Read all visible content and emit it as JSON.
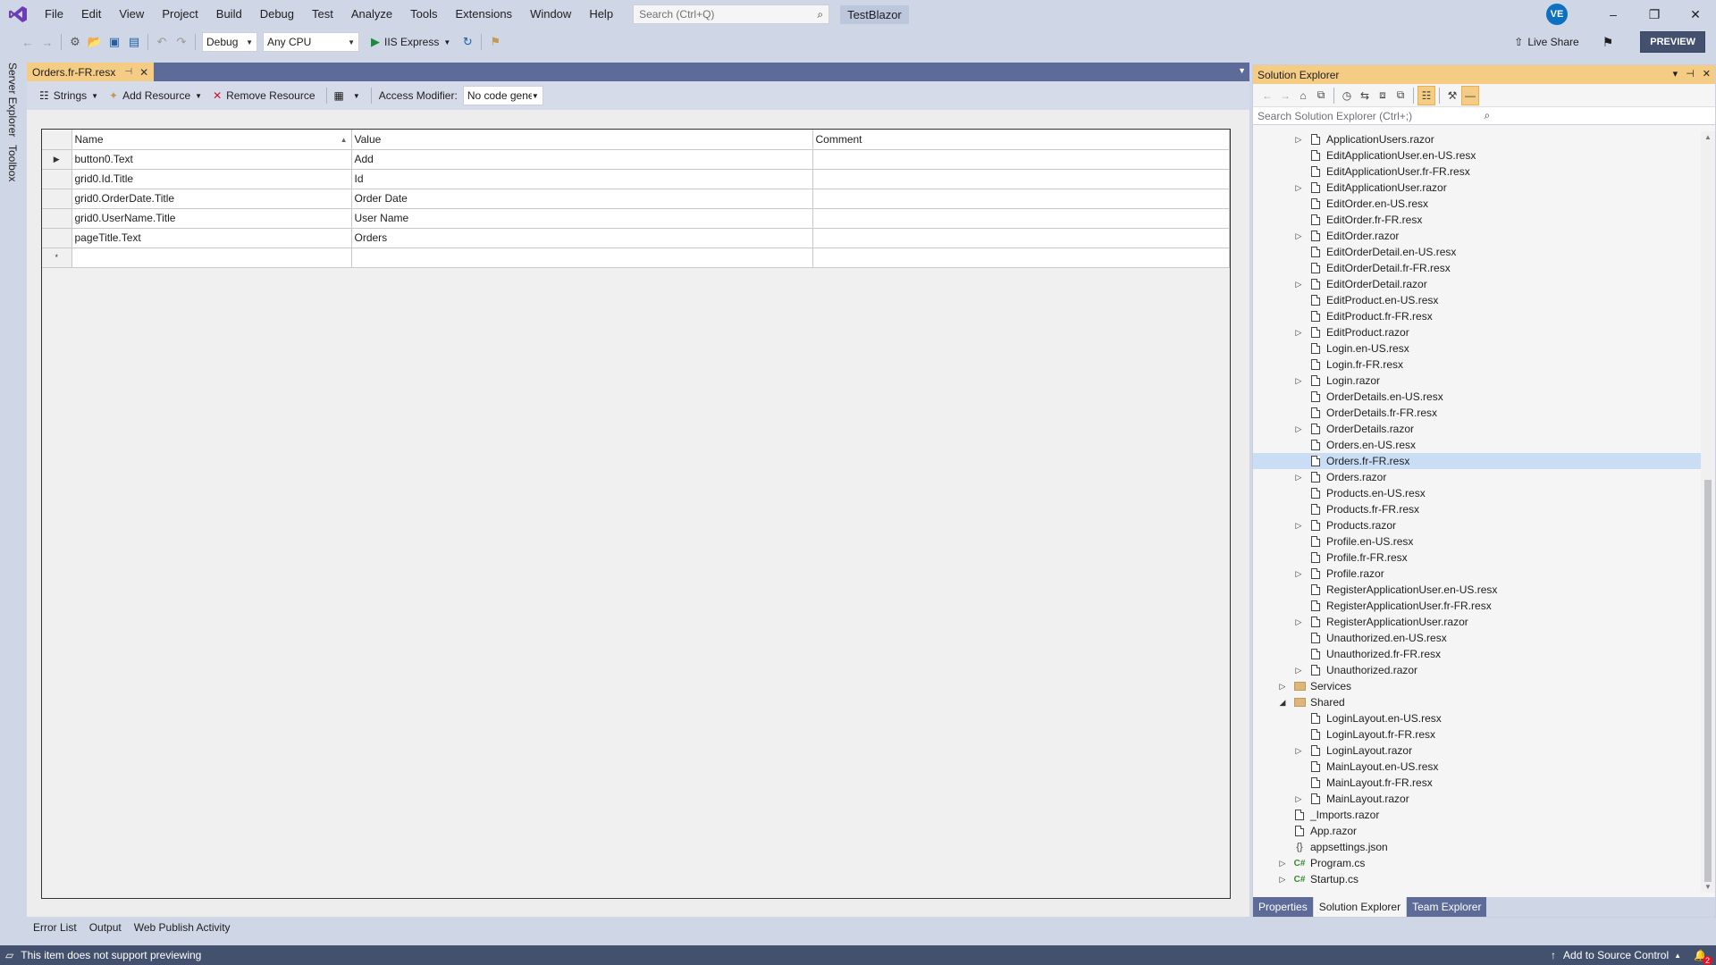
{
  "menu": {
    "items": [
      "File",
      "Edit",
      "View",
      "Project",
      "Build",
      "Debug",
      "Test",
      "Analyze",
      "Tools",
      "Extensions",
      "Window",
      "Help"
    ],
    "search_placeholder": "Search (Ctrl+Q)",
    "solution_name": "TestBlazor",
    "avatar_initials": "VE"
  },
  "toolbar": {
    "configuration": "Debug",
    "platform": "Any CPU",
    "run_label": "IIS Express",
    "live_share": "Live Share",
    "preview": "PREVIEW"
  },
  "left_dock": {
    "tabs": [
      "Server Explorer",
      "Toolbox"
    ]
  },
  "document": {
    "tab_title": "Orders.fr-FR.resx",
    "resource_toolbar": {
      "strings_label": "Strings",
      "add_resource_label": "Add Resource",
      "remove_resource_label": "Remove Resource",
      "access_modifier_label": "Access Modifier:",
      "access_modifier_value": "No code generation"
    },
    "grid": {
      "columns": [
        "Name",
        "Value",
        "Comment"
      ],
      "rows": [
        {
          "name": "button0.Text",
          "value": "Add",
          "comment": ""
        },
        {
          "name": "grid0.Id.Title",
          "value": "Id",
          "comment": ""
        },
        {
          "name": "grid0.OrderDate.Title",
          "value": "Order Date",
          "comment": ""
        },
        {
          "name": "grid0.UserName.Title",
          "value": "User Name",
          "comment": ""
        },
        {
          "name": "pageTitle.Text",
          "value": "Orders",
          "comment": ""
        }
      ],
      "current_row_marker": "▶",
      "new_row_marker": "*"
    }
  },
  "solution_explorer": {
    "title": "Solution Explorer",
    "search_placeholder": "Search Solution Explorer (Ctrl+;)",
    "selected_item": "Orders.fr-FR.resx",
    "items": [
      {
        "label": "ApplicationUsers.razor",
        "level": 3,
        "expandable": true,
        "icon": "file-icon"
      },
      {
        "label": "EditApplicationUser.en-US.resx",
        "level": 3,
        "expandable": false,
        "icon": "file-icon"
      },
      {
        "label": "EditApplicationUser.fr-FR.resx",
        "level": 3,
        "expandable": false,
        "icon": "file-icon"
      },
      {
        "label": "EditApplicationUser.razor",
        "level": 3,
        "expandable": true,
        "icon": "file-icon"
      },
      {
        "label": "EditOrder.en-US.resx",
        "level": 3,
        "expandable": false,
        "icon": "file-icon"
      },
      {
        "label": "EditOrder.fr-FR.resx",
        "level": 3,
        "expandable": false,
        "icon": "file-icon"
      },
      {
        "label": "EditOrder.razor",
        "level": 3,
        "expandable": true,
        "icon": "file-icon"
      },
      {
        "label": "EditOrderDetail.en-US.resx",
        "level": 3,
        "expandable": false,
        "icon": "file-icon"
      },
      {
        "label": "EditOrderDetail.fr-FR.resx",
        "level": 3,
        "expandable": false,
        "icon": "file-icon"
      },
      {
        "label": "EditOrderDetail.razor",
        "level": 3,
        "expandable": true,
        "icon": "file-icon"
      },
      {
        "label": "EditProduct.en-US.resx",
        "level": 3,
        "expandable": false,
        "icon": "file-icon"
      },
      {
        "label": "EditProduct.fr-FR.resx",
        "level": 3,
        "expandable": false,
        "icon": "file-icon"
      },
      {
        "label": "EditProduct.razor",
        "level": 3,
        "expandable": true,
        "icon": "file-icon"
      },
      {
        "label": "Login.en-US.resx",
        "level": 3,
        "expandable": false,
        "icon": "file-icon"
      },
      {
        "label": "Login.fr-FR.resx",
        "level": 3,
        "expandable": false,
        "icon": "file-icon"
      },
      {
        "label": "Login.razor",
        "level": 3,
        "expandable": true,
        "icon": "file-icon"
      },
      {
        "label": "OrderDetails.en-US.resx",
        "level": 3,
        "expandable": false,
        "icon": "file-icon"
      },
      {
        "label": "OrderDetails.fr-FR.resx",
        "level": 3,
        "expandable": false,
        "icon": "file-icon"
      },
      {
        "label": "OrderDetails.razor",
        "level": 3,
        "expandable": true,
        "icon": "file-icon"
      },
      {
        "label": "Orders.en-US.resx",
        "level": 3,
        "expandable": false,
        "icon": "file-icon"
      },
      {
        "label": "Orders.fr-FR.resx",
        "level": 3,
        "expandable": false,
        "icon": "file-icon",
        "selected": true
      },
      {
        "label": "Orders.razor",
        "level": 3,
        "expandable": true,
        "icon": "file-icon"
      },
      {
        "label": "Products.en-US.resx",
        "level": 3,
        "expandable": false,
        "icon": "file-icon"
      },
      {
        "label": "Products.fr-FR.resx",
        "level": 3,
        "expandable": false,
        "icon": "file-icon"
      },
      {
        "label": "Products.razor",
        "level": 3,
        "expandable": true,
        "icon": "file-icon"
      },
      {
        "label": "Profile.en-US.resx",
        "level": 3,
        "expandable": false,
        "icon": "file-icon"
      },
      {
        "label": "Profile.fr-FR.resx",
        "level": 3,
        "expandable": false,
        "icon": "file-icon"
      },
      {
        "label": "Profile.razor",
        "level": 3,
        "expandable": true,
        "icon": "file-icon"
      },
      {
        "label": "RegisterApplicationUser.en-US.resx",
        "level": 3,
        "expandable": false,
        "icon": "file-icon"
      },
      {
        "label": "RegisterApplicationUser.fr-FR.resx",
        "level": 3,
        "expandable": false,
        "icon": "file-icon"
      },
      {
        "label": "RegisterApplicationUser.razor",
        "level": 3,
        "expandable": true,
        "icon": "file-icon"
      },
      {
        "label": "Unauthorized.en-US.resx",
        "level": 3,
        "expandable": false,
        "icon": "file-icon"
      },
      {
        "label": "Unauthorized.fr-FR.resx",
        "level": 3,
        "expandable": false,
        "icon": "file-icon"
      },
      {
        "label": "Unauthorized.razor",
        "level": 3,
        "expandable": true,
        "icon": "file-icon"
      },
      {
        "label": "Services",
        "level": 2,
        "expandable": true,
        "icon": "folder-icon"
      },
      {
        "label": "Shared",
        "level": 2,
        "expandable": true,
        "expanded": true,
        "icon": "folder-open-icon"
      },
      {
        "label": "LoginLayout.en-US.resx",
        "level": 3,
        "expandable": false,
        "icon": "file-icon"
      },
      {
        "label": "LoginLayout.fr-FR.resx",
        "level": 3,
        "expandable": false,
        "icon": "file-icon"
      },
      {
        "label": "LoginLayout.razor",
        "level": 3,
        "expandable": true,
        "icon": "file-icon"
      },
      {
        "label": "MainLayout.en-US.resx",
        "level": 3,
        "expandable": false,
        "icon": "file-icon"
      },
      {
        "label": "MainLayout.fr-FR.resx",
        "level": 3,
        "expandable": false,
        "icon": "file-icon"
      },
      {
        "label": "MainLayout.razor",
        "level": 3,
        "expandable": true,
        "icon": "file-icon"
      },
      {
        "label": "_Imports.razor",
        "level": 2,
        "expandable": false,
        "icon": "file-icon"
      },
      {
        "label": "App.razor",
        "level": 2,
        "expandable": false,
        "icon": "file-icon"
      },
      {
        "label": "appsettings.json",
        "level": 2,
        "expandable": false,
        "icon": "json-icon"
      },
      {
        "label": "Program.cs",
        "level": 2,
        "expandable": true,
        "icon": "csharp-icon"
      },
      {
        "label": "Startup.cs",
        "level": 2,
        "expandable": true,
        "icon": "csharp-icon"
      }
    ],
    "bottom_tabs": [
      "Properties",
      "Solution Explorer",
      "Team Explorer"
    ],
    "active_bottom_tab": "Solution Explorer"
  },
  "tool_tabs": [
    "Error List",
    "Output",
    "Web Publish Activity"
  ],
  "status": {
    "message": "This item does not support previewing",
    "source_control": "Add to Source Control",
    "notification_count": "2"
  },
  "colors": {
    "accent_tab": "#f5cc84",
    "status_bar": "#44516e",
    "selection": "#c9def5",
    "chrome": "#cfd6e5"
  }
}
